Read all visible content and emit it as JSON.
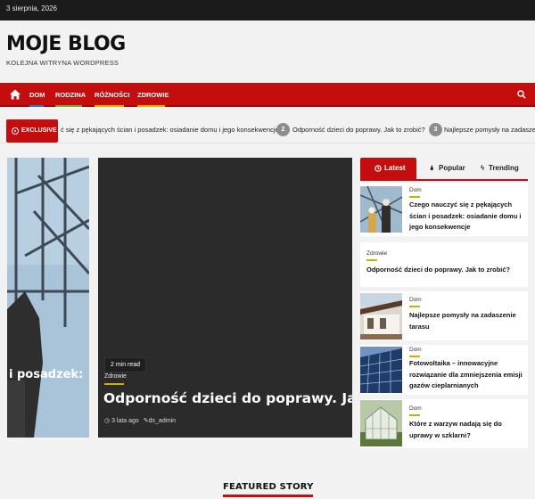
{
  "topbar": {
    "date": "3 sierpnia, 2026"
  },
  "brand": {
    "title": "MOJE BLOG",
    "tagline": "KOLEJNA WITRYNA WORDPRESS"
  },
  "nav": {
    "items": [
      {
        "label": "DOM",
        "color": "#1f7be0"
      },
      {
        "label": "RODZINA",
        "color": "#6fb13a"
      },
      {
        "label": "RÓŻNOŚCI",
        "color": "#d3b800"
      },
      {
        "label": "ZDROWIE",
        "color": "#d3b800"
      }
    ],
    "home_icon": "home-icon",
    "search_icon": "search-icon"
  },
  "ticker": {
    "badge": "EXCLUSIVE",
    "items": [
      {
        "text": "ć się z pękających ścian i posadzek: osiadanie domu i jego konsekwencje"
      },
      {
        "num": "2",
        "text": "Odporność dzieci do poprawy. Jak to zrobić?"
      },
      {
        "num": "3",
        "text": "Najlepsze pomysły na zadaszen"
      }
    ]
  },
  "slider": {
    "left_caption": "i posadzek:",
    "main": {
      "read_time": "2 min read",
      "category": "Zdrowie",
      "title": "Odporność dzieci do poprawy. Jak to",
      "time_ago": "3 lata ago",
      "author": "ds_admin"
    }
  },
  "tabs": [
    {
      "label": "Latest",
      "icon": "clock-icon"
    },
    {
      "label": "Popular",
      "icon": "fire-icon"
    },
    {
      "label": "Trending",
      "icon": "bolt-icon"
    }
  ],
  "sidebar_posts": [
    {
      "category": "Dom",
      "title": "Czego nauczyć się z pękających ścian i posadzek: osiadanie domu i jego konsekwencje",
      "thumb": "construction-workers"
    },
    {
      "category": "Zdrowie",
      "title": "Odporność dzieci do poprawy. Jak to zrobić?"
    },
    {
      "category": "Dom",
      "title": "Najlepsze pomysły na zadaszenie tarasu",
      "thumb": "terrace-house"
    },
    {
      "category": "Dom",
      "title": "Fotowoltaika – innowacyjne rozwiązanie dla zmniejszenia emisji gazów cieplarnianych",
      "thumb": "solar-panels"
    },
    {
      "category": "Dom",
      "title": "Które z warzyw nadają się do uprawy w szklarni?",
      "thumb": "greenhouse"
    }
  ],
  "featured": {
    "title": "FEATURED STORY"
  },
  "colors": {
    "accent": "#c40d0d",
    "topbar": "#1b1b1b",
    "category_bar": "#c9b100"
  }
}
